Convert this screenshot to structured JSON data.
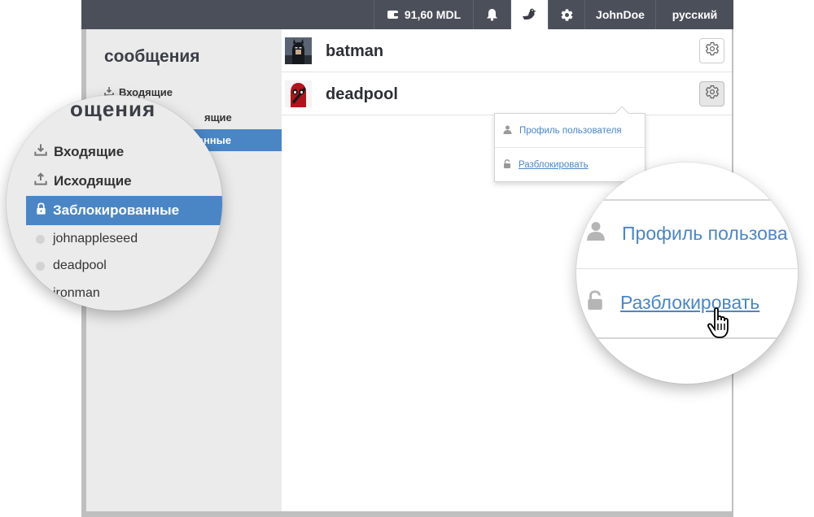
{
  "topbar": {
    "balance": "91,60 MDL",
    "username": "JohnDoe",
    "language": "русский",
    "icons": [
      "wallet-icon",
      "bell-icon",
      "duck-icon",
      "gear-icon"
    ]
  },
  "sidebar": {
    "title": "сообщения",
    "inbox": "Входящие",
    "outbox_fragment": "ящие",
    "blocked_fragment": "анные"
  },
  "messages": [
    {
      "name": "batman"
    },
    {
      "name": "deadpool"
    }
  ],
  "dropdown": {
    "profile": "Профиль пользователя",
    "unblock": "Разблокировать"
  },
  "zoom_left": {
    "title_fragment": "ощения",
    "inbox": "Входящие",
    "outbox": "Исходящие",
    "blocked": "Заблокированные",
    "users": [
      "johnappleseed",
      "deadpool",
      "ironman"
    ]
  },
  "zoom_right": {
    "profile": "Профиль пользова",
    "unblock": "Разблокировать"
  },
  "colors": {
    "topbar": "#4b4f59",
    "accent": "#4a86c6",
    "sidebar": "#ebebeb"
  }
}
